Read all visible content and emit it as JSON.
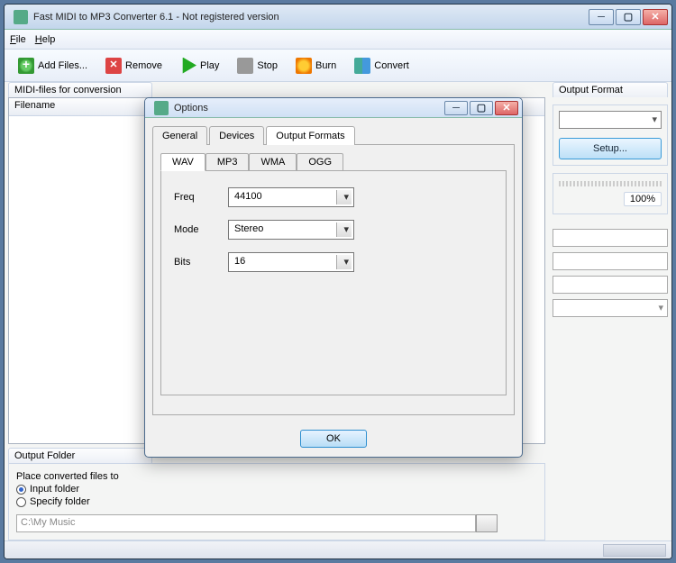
{
  "window": {
    "title": "Fast MIDI to MP3 Converter 6.1 - Not registered version"
  },
  "menubar": {
    "file": "File",
    "help": "Help"
  },
  "toolbar": {
    "add": "Add Files...",
    "remove": "Remove",
    "play": "Play",
    "stop": "Stop",
    "burn": "Burn",
    "convert": "Convert"
  },
  "left_panel": {
    "label": "MIDI-files for conversion",
    "filelist_header": "Filename",
    "output_folder_tab": "Output Folder",
    "place_label": "Place converted files to",
    "radio_input": "Input folder",
    "radio_specify": "Specify folder",
    "path_value": "C:\\My Music"
  },
  "right_panel": {
    "label": "Output Format",
    "setup": "Setup...",
    "progress_pct": "100%"
  },
  "dialog": {
    "title": "Options",
    "tabs": {
      "general": "General",
      "devices": "Devices",
      "formats": "Output Formats"
    },
    "subtabs": {
      "wav": "WAV",
      "mp3": "MP3",
      "wma": "WMA",
      "ogg": "OGG"
    },
    "fields": {
      "freq_label": "Freq",
      "freq_value": "44100",
      "mode_label": "Mode",
      "mode_value": "Stereo",
      "bits_label": "Bits",
      "bits_value": "16"
    },
    "ok": "OK"
  }
}
